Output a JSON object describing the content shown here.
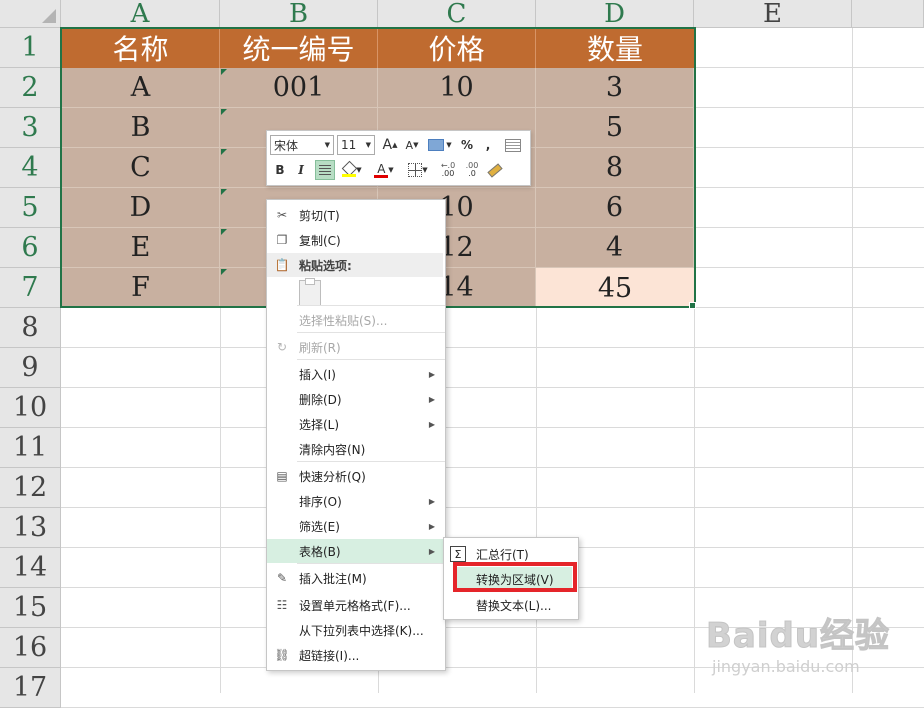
{
  "columns": [
    "A",
    "B",
    "C",
    "D",
    "E"
  ],
  "rows": [
    "1",
    "2",
    "3",
    "4",
    "5",
    "6",
    "7",
    "8",
    "9",
    "10",
    "11",
    "12",
    "13",
    "14",
    "15",
    "16",
    "17"
  ],
  "table": {
    "headers": [
      "名称",
      "统一编号",
      "价格",
      "数量"
    ],
    "visible_cells": [
      [
        "A",
        "001",
        "10",
        "3"
      ],
      [
        "B",
        "",
        "",
        "5"
      ],
      [
        "C",
        "",
        "",
        "8"
      ],
      [
        "D",
        "",
        "10",
        "6"
      ],
      [
        "E",
        "",
        "12",
        "4"
      ],
      [
        "F",
        "",
        "14",
        "45"
      ]
    ]
  },
  "mini_toolbar": {
    "font_name": "宋体",
    "font_size": "11",
    "bold": "B",
    "italic": "I",
    "percent": "%",
    "comma": ",",
    "font_color_letter": "A",
    "grow_font": "A",
    "shrink_font": "A",
    "increase_decimal": ".00",
    "decrease_decimal": ".0"
  },
  "context_menu": {
    "items": [
      {
        "label": "剪切(T)",
        "icon": "scissors-icon"
      },
      {
        "label": "复制(C)",
        "icon": "copy-icon"
      },
      {
        "label": "粘贴选项:",
        "icon": "paste-icon"
      },
      {
        "label": "选择性粘贴(S)...",
        "icon": ""
      },
      {
        "label": "刷新(R)",
        "icon": "refresh-icon"
      },
      {
        "label": "插入(I)",
        "icon": ""
      },
      {
        "label": "删除(D)",
        "icon": ""
      },
      {
        "label": "选择(L)",
        "icon": ""
      },
      {
        "label": "清除内容(N)",
        "icon": ""
      },
      {
        "label": "快速分析(Q)",
        "icon": "quick-analysis-icon"
      },
      {
        "label": "排序(O)",
        "icon": ""
      },
      {
        "label": "筛选(E)",
        "icon": ""
      },
      {
        "label": "表格(B)",
        "icon": ""
      },
      {
        "label": "插入批注(M)",
        "icon": "comment-icon"
      },
      {
        "label": "设置单元格格式(F)...",
        "icon": "format-cells-icon"
      },
      {
        "label": "从下拉列表中选择(K)...",
        "icon": ""
      },
      {
        "label": "超链接(I)...",
        "icon": "hyperlink-icon"
      }
    ]
  },
  "submenu": {
    "items": [
      {
        "label": "汇总行(T)",
        "icon": "sum-icon"
      },
      {
        "label": "转换为区域(V)",
        "icon": ""
      },
      {
        "label": "替换文本(L)...",
        "icon": ""
      }
    ]
  },
  "watermark": {
    "brand": "Baidu经验",
    "url": "jingyan.baidu.com"
  },
  "colors": {
    "header_fill": "#bf6b30",
    "data_fill": "#c8b0a0",
    "highlight_fill": "#fce4d6",
    "selection_border": "#217346",
    "menu_highlight": "#d7efe1",
    "callout_red": "#e5252a"
  }
}
